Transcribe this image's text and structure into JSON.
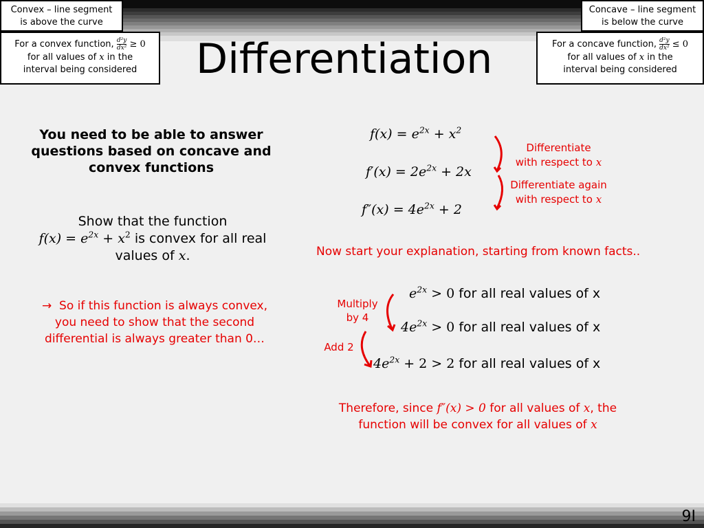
{
  "title": "Differentiation",
  "slide_number": "9I",
  "convex_box": {
    "heading_line1": "Convex – line segment",
    "heading_line2": "is above the curve",
    "rule_prefix": "For a convex function,",
    "frac_num": "d²y",
    "frac_den": "dx²",
    "rule_relation": "≥ 0",
    "rule_line2_a": "for all values of",
    "rule_line2_var": "x",
    "rule_line2_b": "in the",
    "rule_line3": "interval being considered"
  },
  "concave_box": {
    "heading_line1": "Concave – line segment",
    "heading_line2": "is below the curve",
    "rule_prefix": "For a concave function,",
    "frac_num": "d²y",
    "frac_den": "dx²",
    "rule_relation": "≤ 0",
    "rule_line2_a": "for all values of",
    "rule_line2_var": "x",
    "rule_line2_b": "in the",
    "rule_line3": "interval being considered"
  },
  "left": {
    "intro_line1": "You need to be able to answer",
    "intro_line2": "questions based on concave and",
    "intro_line3": "convex functions",
    "question_line1": "Show that the function",
    "question_fx": "f(x) = e",
    "question_exp": "2x",
    "question_plus": " + x",
    "question_sq": "2",
    "question_tail": " is convex for all real",
    "question_line3_a": "values of ",
    "question_line3_var": "x",
    "question_line3_b": ".",
    "hint_arrow": "→",
    "hint_line1": "So if this function is always convex,",
    "hint_line2": "you need to show that the second",
    "hint_line3": "differential is always greater than 0…"
  },
  "right": {
    "eq1": {
      "lhs": "f(x) = e",
      "exp": "2x",
      "rest": " + x",
      "sq": "2"
    },
    "eq2": {
      "lhs": "f′(x) = 2e",
      "exp": "2x",
      "rest": " + 2x"
    },
    "eq3": {
      "lhs": "f″(x) = 4e",
      "exp": "2x",
      "rest": " + 2"
    },
    "annot1_line1": "Differentiate",
    "annot1_line2": "with respect to ",
    "annot1_var": "x",
    "annot2_line1": "Differentiate again",
    "annot2_line2": "with respect to ",
    "annot2_var": "x",
    "explain": "Now start your explanation, starting from known facts..",
    "facts": [
      {
        "math": "e",
        "exp": "2x",
        "rel": " > 0",
        "text": "for all real values of x"
      },
      {
        "math": "4e",
        "exp": "2x",
        "rel": " > 0",
        "text": "for all real values of x"
      },
      {
        "math": "4e",
        "exp": "2x",
        "rel": " + 2 > 2",
        "text": "for all real values of x"
      }
    ],
    "step1_line1": "Multiply",
    "step1_line2": "by 4",
    "step2": "Add 2",
    "conclusion_a": "Therefore, since ",
    "conclusion_math": "f″(x) > 0",
    "conclusion_b": " for all values of ",
    "conclusion_var": "x",
    "conclusion_c": ", the",
    "conclusion_line2_a": "function will be convex for all values of ",
    "conclusion_line2_var": "x"
  },
  "colors": {
    "accent_red": "#e60000"
  }
}
